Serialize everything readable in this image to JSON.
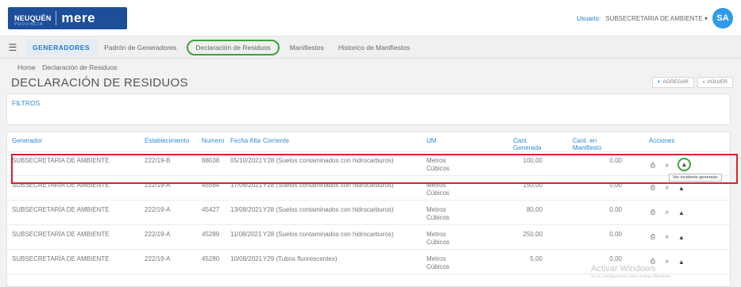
{
  "header": {
    "logo_left": "NEUQUÉN",
    "logo_sub": "PROVINCIA",
    "logo_right": "mere",
    "user_label": "Usuario:",
    "user_name": "SUBSECRETARIA DE AMBIENTE ▾",
    "avatar_initials": "SA"
  },
  "nav": {
    "items": [
      "GENERADORES",
      "Padrón de Generadores",
      "Declaración de Residuos",
      "Manifiestos",
      "Historico de Manifiestos"
    ]
  },
  "breadcrumb": [
    "Home",
    "Declaración de Residuos"
  ],
  "page": {
    "title": "DECLARACIÓN DE RESIDUOS",
    "add_label": "AGREGAR",
    "back_label": "VOLVER"
  },
  "filters": {
    "label": "FILTROS"
  },
  "table": {
    "columns": [
      "Generador",
      "Establecimiento",
      "Numero",
      "Fecha Alta",
      "Corriente",
      "UM",
      "Cant. Generada",
      "Cant. en Manifiesto",
      "Acciones"
    ],
    "rows": [
      {
        "generador": "SUBSECRETARÍA DE AMBIENTE",
        "establecimiento": "222/19-B",
        "numero": "88038",
        "fecha": "05/10/2021",
        "corriente": "Y28 (Suelos contaminados con hidrocarburos)",
        "um": "Metros Cúbicos",
        "cant_generada": "100,00",
        "cant_manifiesto": "0,00"
      },
      {
        "generador": "SUBSECRETARÍA DE AMBIENTE",
        "establecimiento": "222/19-A",
        "numero": "45584",
        "fecha": "17/08/2021",
        "corriente": "Y28 (Suelos contaminados con hidrocarburos)",
        "um": "Metros Cúbicos",
        "cant_generada": "150,00",
        "cant_manifiesto": "0,00"
      },
      {
        "generador": "SUBSECRETARÍA DE AMBIENTE",
        "establecimiento": "222/19-A",
        "numero": "45427",
        "fecha": "13/08/2021",
        "corriente": "Y28 (Suelos contaminados con hidrocarburos)",
        "um": "Metros Cúbicos",
        "cant_generada": "80,00",
        "cant_manifiesto": "0,00"
      },
      {
        "generador": "SUBSECRETARÍA DE AMBIENTE",
        "establecimiento": "222/19-A",
        "numero": "45289",
        "fecha": "11/08/2021",
        "corriente": "Y28 (Suelos contaminados con hidrocarburos)",
        "um": "Metros Cúbicos",
        "cant_generada": "250,00",
        "cant_manifiesto": "0,00"
      },
      {
        "generador": "SUBSECRETARÍA DE AMBIENTE",
        "establecimiento": "222/19-A",
        "numero": "45280",
        "fecha": "10/08/2021",
        "corriente": "Y29 (Tubos fluorescentes)",
        "um": "Metros Cúbicos",
        "cant_generada": "5,00",
        "cant_manifiesto": "0,00"
      }
    ],
    "action_icons": [
      "print-icon",
      "search-icon",
      "warning-icon"
    ]
  },
  "tooltip": "Ver incidente generado",
  "watermark": {
    "title": "Activar Windows",
    "subtitle": "Ve a Configuración para activar Windows."
  },
  "colors": {
    "accent": "#1d7ad0",
    "highlight_red": "#d7242c",
    "highlight_green": "#3fa53a",
    "logo_bg": "#1d4e9a"
  }
}
